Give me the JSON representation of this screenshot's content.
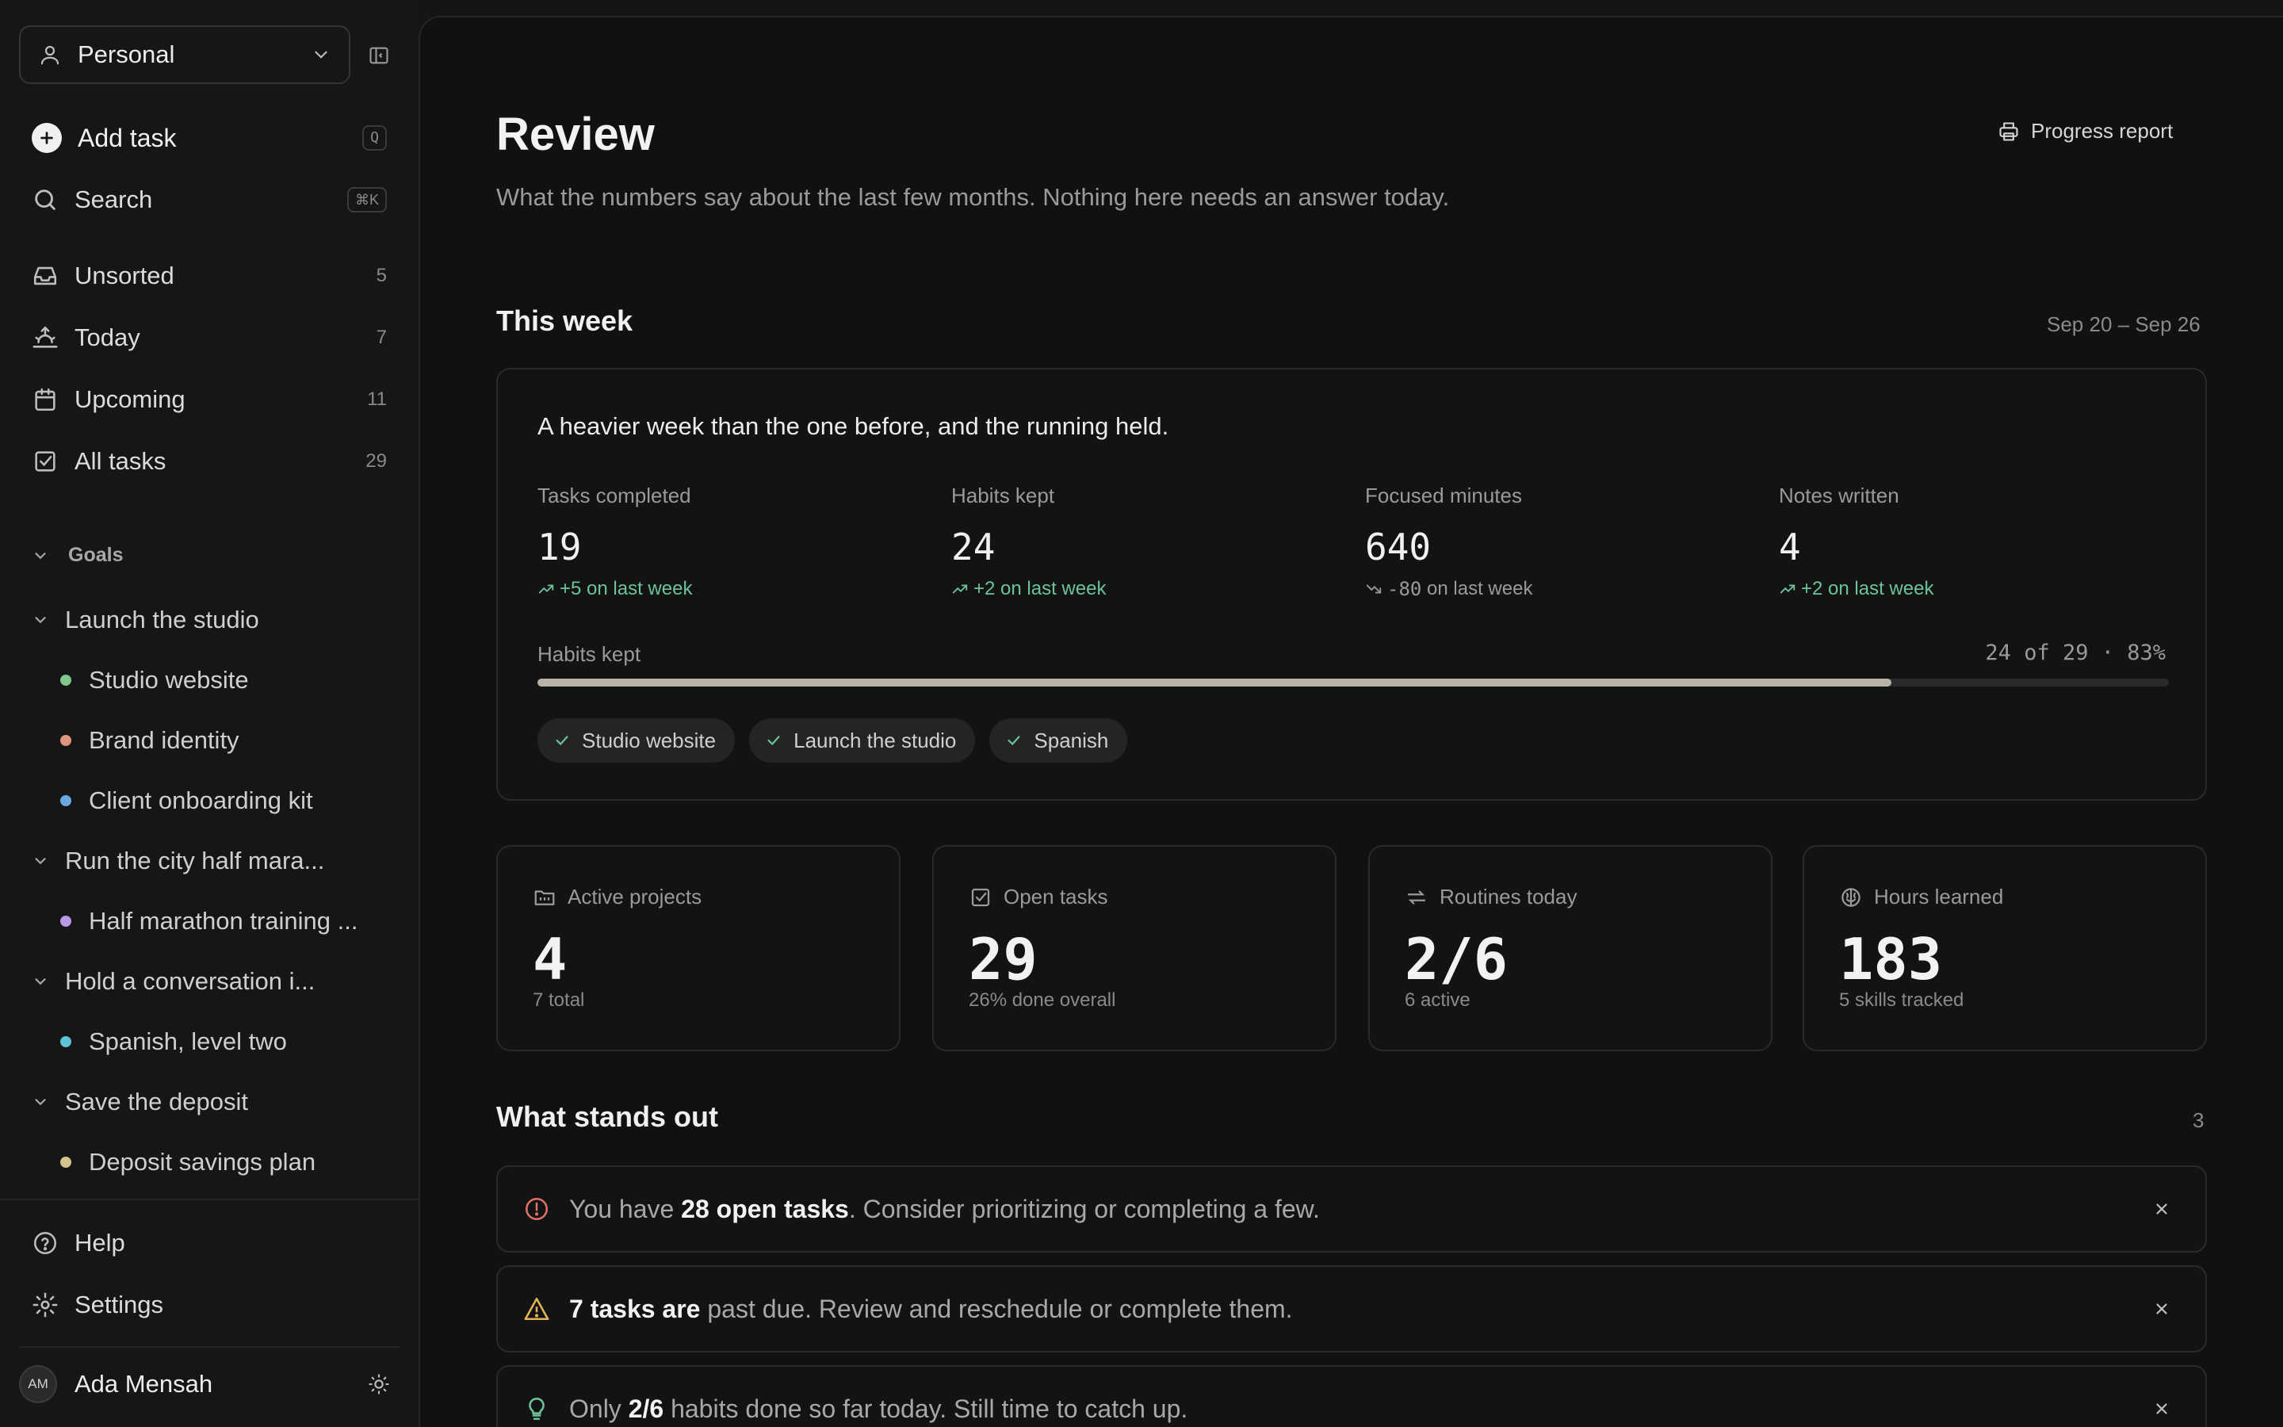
{
  "workspace": {
    "name": "Personal"
  },
  "sidebar": {
    "add_task": {
      "label": "Add task",
      "shortcut": "Q"
    },
    "search": {
      "label": "Search",
      "shortcut": "⌘K"
    },
    "nav": [
      {
        "label": "Unsorted",
        "count": "5"
      },
      {
        "label": "Today",
        "count": "7"
      },
      {
        "label": "Upcoming",
        "count": "11"
      },
      {
        "label": "All tasks",
        "count": "29"
      }
    ],
    "goals_label": "Goals",
    "goals": [
      {
        "label": "Launch the studio",
        "projects": [
          {
            "label": "Studio website",
            "color": "#7fc98b"
          },
          {
            "label": "Brand identity",
            "color": "#e0957e"
          },
          {
            "label": "Client onboarding kit",
            "color": "#6aa8e0"
          }
        ]
      },
      {
        "label": "Run the city half mara...",
        "projects": [
          {
            "label": "Half marathon training ...",
            "color": "#b89ae6"
          }
        ]
      },
      {
        "label": "Hold a conversation i...",
        "projects": [
          {
            "label": "Spanish, level two",
            "color": "#5fc2d6"
          }
        ]
      },
      {
        "label": "Save the deposit",
        "projects": [
          {
            "label": "Deposit savings plan",
            "color": "#d4c48a"
          }
        ]
      }
    ],
    "help": "Help",
    "settings": "Settings",
    "user": {
      "initials": "AM",
      "name": "Ada Mensah"
    }
  },
  "page": {
    "title": "Review",
    "subtitle": "What the numbers say about the last few months. Nothing here needs an answer today.",
    "report_button": "Progress report"
  },
  "week": {
    "title": "This week",
    "range": "Sep 20 – Sep 26",
    "summary": "A heavier week than the one before, and the running held.",
    "stats": [
      {
        "label": "Tasks completed",
        "value": "19",
        "delta_num": "+5",
        "delta_text": "on last week",
        "trend": "up"
      },
      {
        "label": "Habits kept",
        "value": "24",
        "delta_num": "+2",
        "delta_text": "on last week",
        "trend": "up"
      },
      {
        "label": "Focused minutes",
        "value": "640",
        "delta_num": "-80",
        "delta_text": "on last week",
        "trend": "down"
      },
      {
        "label": "Notes written",
        "value": "4",
        "delta_num": "+2",
        "delta_text": "on last week",
        "trend": "up"
      }
    ],
    "habits": {
      "label": "Habits kept",
      "ratio_text": "24 of 29 · 83%",
      "fraction": 0.83
    },
    "chips": [
      "Studio website",
      "Launch the studio",
      "Spanish"
    ]
  },
  "metrics": [
    {
      "label": "Active projects",
      "value": "4",
      "sub": "7 total",
      "icon": "folder-icon"
    },
    {
      "label": "Open tasks",
      "value": "29",
      "sub": "26% done overall",
      "icon": "checkbox-icon"
    },
    {
      "label": "Routines today",
      "value": "2/6",
      "sub": "6 active",
      "icon": "repeat-icon"
    },
    {
      "label": "Hours learned",
      "value": "183",
      "sub": "5 skills tracked",
      "icon": "brain-icon"
    }
  ],
  "standout": {
    "title": "What stands out",
    "count": "3",
    "alerts": [
      {
        "icon": "alert-circle-icon",
        "pre": "You have ",
        "bold": "28 open tasks",
        "post": ". Consider prioritizing or completing a few.",
        "color": "#e0706a"
      },
      {
        "icon": "warning-triangle-icon",
        "pre": "",
        "bold": "7 tasks are",
        "post": " past due. Review and reschedule or complete them.",
        "color": "#e0b45a"
      },
      {
        "icon": "lightbulb-icon",
        "pre": "Only ",
        "bold": "2/6",
        "post": " habits done so far today. Still time to catch up.",
        "color": "#6cc39a"
      }
    ]
  },
  "colors": {
    "accent_green": "#6cc39a",
    "progress_fill": "#b8b2a8",
    "background": "#111111"
  }
}
